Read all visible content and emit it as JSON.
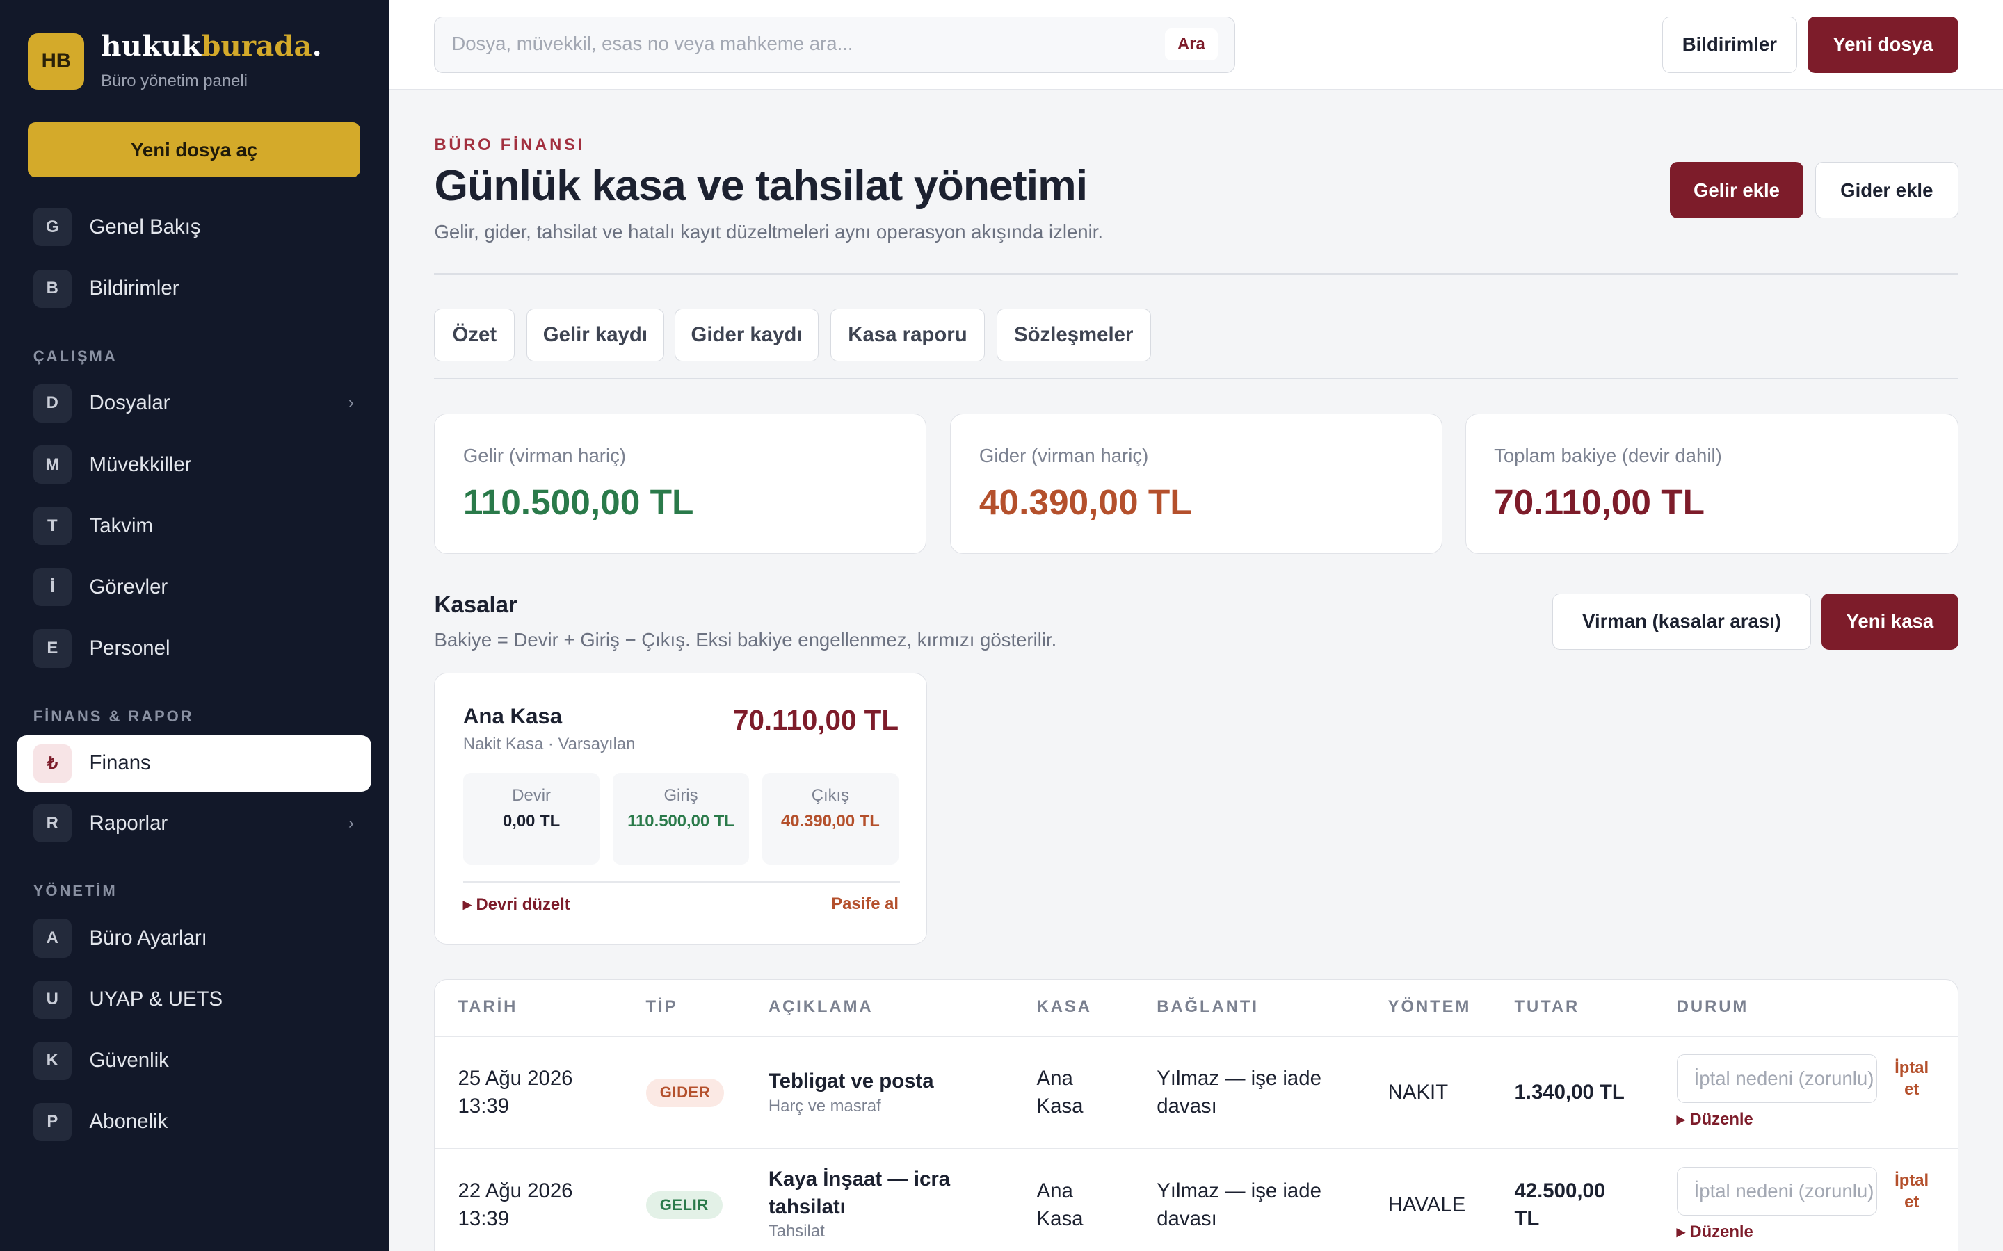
{
  "brand": {
    "logo": "HB",
    "name_part1": "hukuk",
    "name_part2": "burada",
    "name_dot": ".",
    "subtitle": "Büro yönetim paneli"
  },
  "sidebar": {
    "new_file_label": "Yeni dosya aç",
    "items_top": [
      {
        "letter": "G",
        "label": "Genel Bakış"
      },
      {
        "letter": "B",
        "label": "Bildirimler"
      }
    ],
    "section_work": "ÇALIŞMA",
    "items_work": [
      {
        "letter": "D",
        "label": "Dosyalar",
        "chevron": "›"
      },
      {
        "letter": "M",
        "label": "Müvekkiller"
      },
      {
        "letter": "T",
        "label": "Takvim"
      },
      {
        "letter": "İ",
        "label": "Görevler"
      },
      {
        "letter": "E",
        "label": "Personel"
      }
    ],
    "section_finance": "FİNANS & RAPOR",
    "items_finance": [
      {
        "letter": "₺",
        "label": "Finans",
        "active": true
      },
      {
        "letter": "R",
        "label": "Raporlar",
        "chevron": "›"
      }
    ],
    "section_admin": "YÖNETİM",
    "items_admin": [
      {
        "letter": "A",
        "label": "Büro Ayarları"
      },
      {
        "letter": "U",
        "label": "UYAP & UETS"
      },
      {
        "letter": "K",
        "label": "Güvenlik"
      },
      {
        "letter": "P",
        "label": "Abonelik"
      }
    ]
  },
  "topbar": {
    "search_placeholder": "Dosya, müvekkil, esas no veya mahkeme ara...",
    "search_button": "Ara",
    "notifications_button": "Bildirimler",
    "new_file_button": "Yeni dosya"
  },
  "header": {
    "eyebrow": "BÜRO FİNANSI",
    "title": "Günlük kasa ve tahsilat yönetimi",
    "subtitle": "Gelir, gider, tahsilat ve hatalı kayıt düzeltmeleri aynı operasyon akışında izlenir.",
    "add_income": "Gelir ekle",
    "add_expense": "Gider ekle"
  },
  "tabs": [
    "Özet",
    "Gelir kaydı",
    "Gider kaydı",
    "Kasa raporu",
    "Sözleşmeler"
  ],
  "stats": [
    {
      "label": "Gelir (virman hariç)",
      "value": "110.500,00 TL",
      "color": "#2a7a4a"
    },
    {
      "label": "Gider (virman hariç)",
      "value": "40.390,00 TL",
      "color": "#b4502c"
    },
    {
      "label": "Toplam bakiye (devir dahil)",
      "value": "70.110,00 TL",
      "color": "#7d1c2a"
    }
  ],
  "kasalar": {
    "title": "Kasalar",
    "subtitle": "Bakiye = Devir + Giriş − Çıkış. Eksi bakiye engellenmez, kırmızı gösterilir.",
    "transfer_button": "Virman (kasalar arası)",
    "new_button": "Yeni kasa",
    "card": {
      "name": "Ana Kasa",
      "type": "Nakit Kasa · Varsayılan",
      "balance": "70.110,00 TL",
      "devir_label": "Devir",
      "devir_value": "0,00 TL",
      "giris_label": "Giriş",
      "giris_value": "110.500,00 TL",
      "cikis_label": "Çıkış",
      "cikis_value": "40.390,00 TL",
      "edit_link": "▸ Devri düzelt",
      "deactivate_link": "Pasife al"
    }
  },
  "table": {
    "headers": [
      "TARİH",
      "TİP",
      "AÇIKLAMA",
      "KASA",
      "BAĞLANTI",
      "YÖNTEM",
      "TUTAR",
      "DURUM"
    ],
    "rows": [
      {
        "date": "25 Ağu 2026",
        "time": "13:39",
        "type": "GIDER",
        "desc_title": "Tebligat ve posta",
        "desc_sub": "Harç ve masraf",
        "kasa_1": "Ana",
        "kasa_2": "Kasa",
        "link_1": "Yılmaz — işe iade",
        "link_2": "davası",
        "method": "NAKIT",
        "amount": "1.340,00 TL",
        "reason_placeholder": "İptal nedeni (zorunlu)",
        "cancel_1": "İptal",
        "cancel_2": "et",
        "edit": "▸ Düzenle"
      },
      {
        "date": "22 Ağu 2026",
        "time": "13:39",
        "type": "GELIR",
        "desc_title_1": "Kaya İnşaat — icra",
        "desc_title_2": "tahsilatı",
        "desc_sub": "Tahsilat",
        "kasa_1": "Ana",
        "kasa_2": "Kasa",
        "link_1": "Yılmaz — işe iade",
        "link_2": "davası",
        "method": "HAVALE",
        "amount_1": "42.500,00",
        "amount_2": "TL",
        "reason_placeholder": "İptal nedeni (zorunlu)",
        "cancel_1": "İptal",
        "cancel_2": "et",
        "edit": "▸ Düzenle"
      }
    ]
  }
}
